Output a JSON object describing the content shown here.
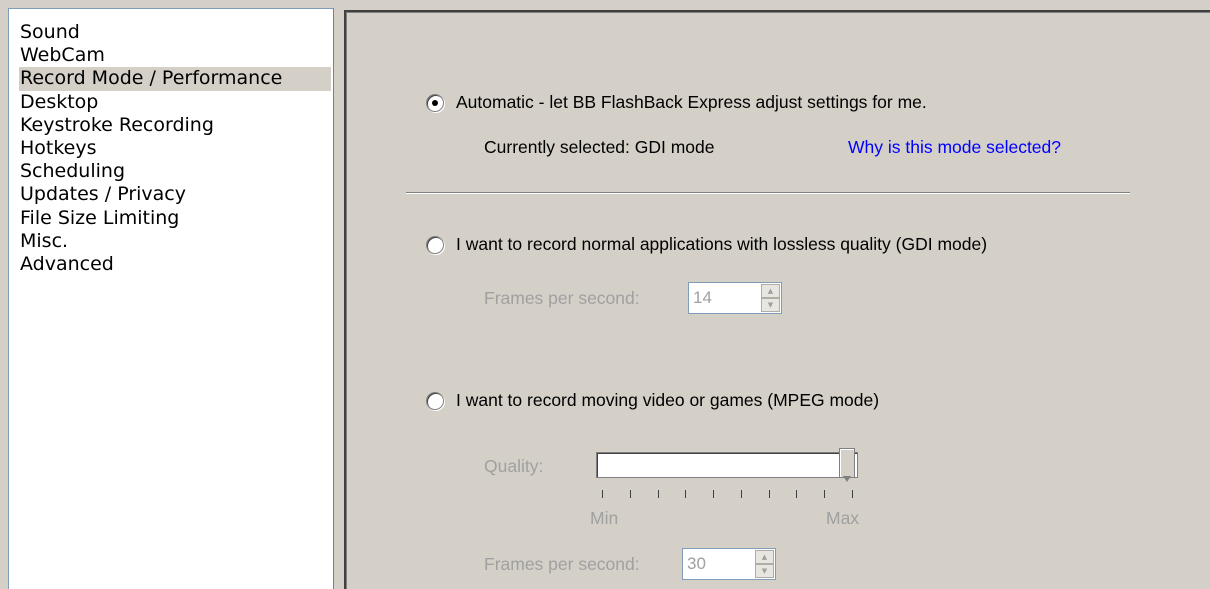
{
  "sidebar": {
    "items": [
      {
        "label": "Sound"
      },
      {
        "label": "WebCam"
      },
      {
        "label": "Record Mode / Performance",
        "selected": true
      },
      {
        "label": "Desktop"
      },
      {
        "label": "Keystroke Recording"
      },
      {
        "label": "Hotkeys"
      },
      {
        "label": "Scheduling"
      },
      {
        "label": "Updates / Privacy"
      },
      {
        "label": "File Size Limiting"
      },
      {
        "label": "Misc."
      },
      {
        "label": "Advanced"
      }
    ]
  },
  "record_mode": {
    "automatic": {
      "label": "Automatic - let BB FlashBack Express adjust settings for me.",
      "selected": true,
      "current_text": "Currently selected: GDI mode",
      "why_link": "Why is this mode selected?"
    },
    "gdi": {
      "label": "I want to record normal applications with lossless quality (GDI mode)",
      "selected": false,
      "fps_label": "Frames per second:",
      "fps_value": "14"
    },
    "mpeg": {
      "label": "I want to record moving video or games (MPEG mode)",
      "selected": false,
      "quality_label": "Quality:",
      "quality_level": 1.0,
      "min_label": "Min",
      "max_label": "Max",
      "fps_label": "Frames per second:",
      "fps_value": "30"
    }
  },
  "icons": {
    "spin_up": "spin-up-arrow",
    "spin_down": "spin-down-arrow"
  },
  "colors": {
    "dialog_bg": "#d4d0c8",
    "link": "#0000ff",
    "disabled_text": "#a0a0a0"
  }
}
